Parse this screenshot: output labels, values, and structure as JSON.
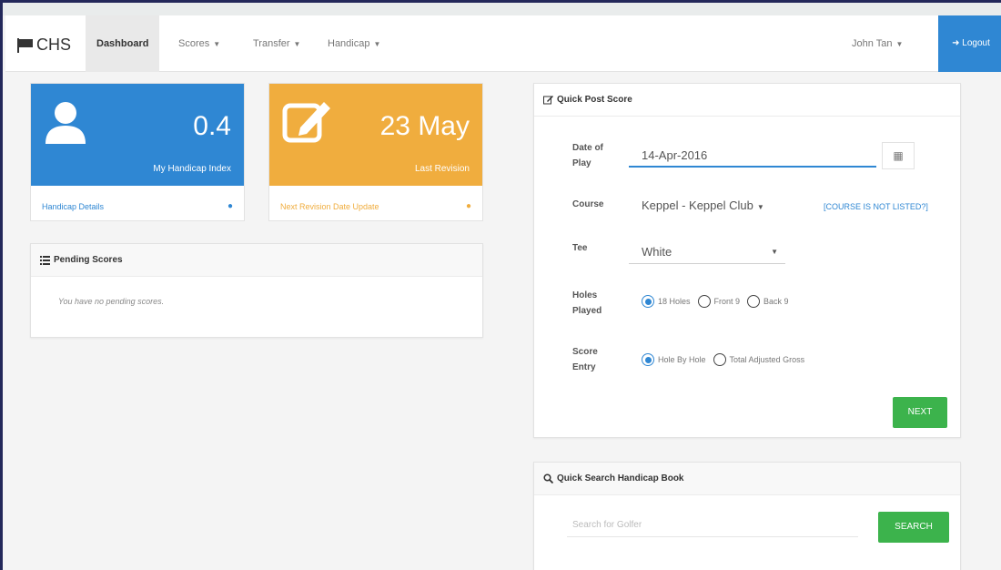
{
  "navbar": {
    "brand": "CHS",
    "items": [
      {
        "label": "Dashboard"
      },
      {
        "label": "Scores"
      },
      {
        "label": "Transfer"
      },
      {
        "label": "Handicap"
      }
    ],
    "user": "John Tan",
    "logout": "Logout"
  },
  "tiles": {
    "handicap": {
      "value": "0.4",
      "caption": "My Handicap Index",
      "link": "Handicap Details",
      "color": "#2f87d3"
    },
    "revision": {
      "value": "23 May",
      "caption": "Last Revision",
      "link": "Next Revision Date Update",
      "color": "#f0ad3e"
    }
  },
  "pending": {
    "title": "Pending Scores",
    "message": "You have no pending scores."
  },
  "quick_post": {
    "title": "Quick Post Score",
    "date_label_1": "Date of",
    "date_label_2": "Play",
    "date_value": "14-Apr-2016",
    "course_label": "Course",
    "course_value": "Keppel - Keppel Club",
    "course_link": "[COURSE IS NOT LISTED?]",
    "tee_label": "Tee",
    "tee_value": "White",
    "holes_label_1": "Holes",
    "holes_label_2": "Played",
    "holes_options": [
      "18 Holes",
      "Front 9",
      "Back 9"
    ],
    "holes_selected": "18 Holes",
    "entry_label_1": "Score",
    "entry_label_2": "Entry",
    "entry_options": [
      "Hole By Hole",
      "Total Adjusted Gross"
    ],
    "entry_selected": "Hole By Hole",
    "next_label": "NEXT"
  },
  "quick_search": {
    "title": "Quick Search Handicap Book",
    "placeholder": "Search for Golfer",
    "search_label": "SEARCH"
  },
  "colors": {
    "primary": "#2f87d3",
    "warning": "#f0ad3e",
    "success": "#3cb34c"
  }
}
